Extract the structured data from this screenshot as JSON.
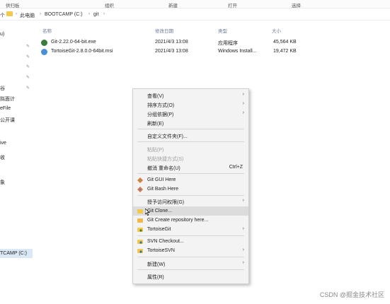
{
  "ribbon": {
    "tabs": [
      "供归板",
      "组织",
      "新建",
      "打开",
      "选择"
    ]
  },
  "address": {
    "crumbs": [
      "此电脑",
      "BOOTCAMP (C:)",
      "git"
    ],
    "left_fragment": "个"
  },
  "sidebar": {
    "items": [
      "u)",
      "谷",
      "拟面计",
      "eFile",
      "公开课",
      "ive",
      "收",
      "象",
      "TCAMP (C:)"
    ]
  },
  "columns": {
    "name": "名称",
    "date": "修改日期",
    "type": "类型",
    "size": "大小"
  },
  "files": [
    {
      "name": "Git-2.22.0-64-bit.exe",
      "date": "2021/4/3 13:08",
      "type": "应用程序",
      "size": "45,564 KB",
      "icon_color": "#3a7d3a"
    },
    {
      "name": "TortoiseGit-2.8.0.0-64bit.msi",
      "date": "2021/4/3 13:08",
      "type": "Windows Install...",
      "size": "19,472 KB",
      "icon_color": "#4a90d9"
    }
  ],
  "context_menu": {
    "items": [
      {
        "label": "查看(V)",
        "submenu": true
      },
      {
        "label": "排序方式(O)",
        "submenu": true
      },
      {
        "label": "分组依据(P)",
        "submenu": true
      },
      {
        "label": "刷新(E)"
      },
      {
        "label": "自定义文件夹(F)..."
      },
      {
        "label": "粘贴(P)",
        "disabled": true
      },
      {
        "label": "粘贴快捷方式(S)",
        "disabled": true
      },
      {
        "label": "撤消 重命名(U)",
        "shortcut": "Ctrl+Z"
      },
      {
        "label": "Git GUI Here",
        "icon": "git-gui-icon"
      },
      {
        "label": "Git Bash Here",
        "icon": "git-bash-icon"
      },
      {
        "label": "授予访问权限(G)",
        "submenu": true
      },
      {
        "label": "Git Clone...",
        "icon": "git-clone-icon"
      },
      {
        "label": "Git Create repository here...",
        "icon": "git-create-icon"
      },
      {
        "label": "TortoiseGit",
        "icon": "tortoisegit-icon",
        "submenu": true
      },
      {
        "label": "SVN Checkout...",
        "icon": "svn-checkout-icon"
      },
      {
        "label": "TortoiseSVN",
        "icon": "tortoisesvn-icon",
        "submenu": true
      },
      {
        "label": "新建(W)",
        "submenu": true
      },
      {
        "label": "属性(R)"
      }
    ],
    "submenu_arrow": "›"
  },
  "watermark": "CSDN @掘金技术社区"
}
